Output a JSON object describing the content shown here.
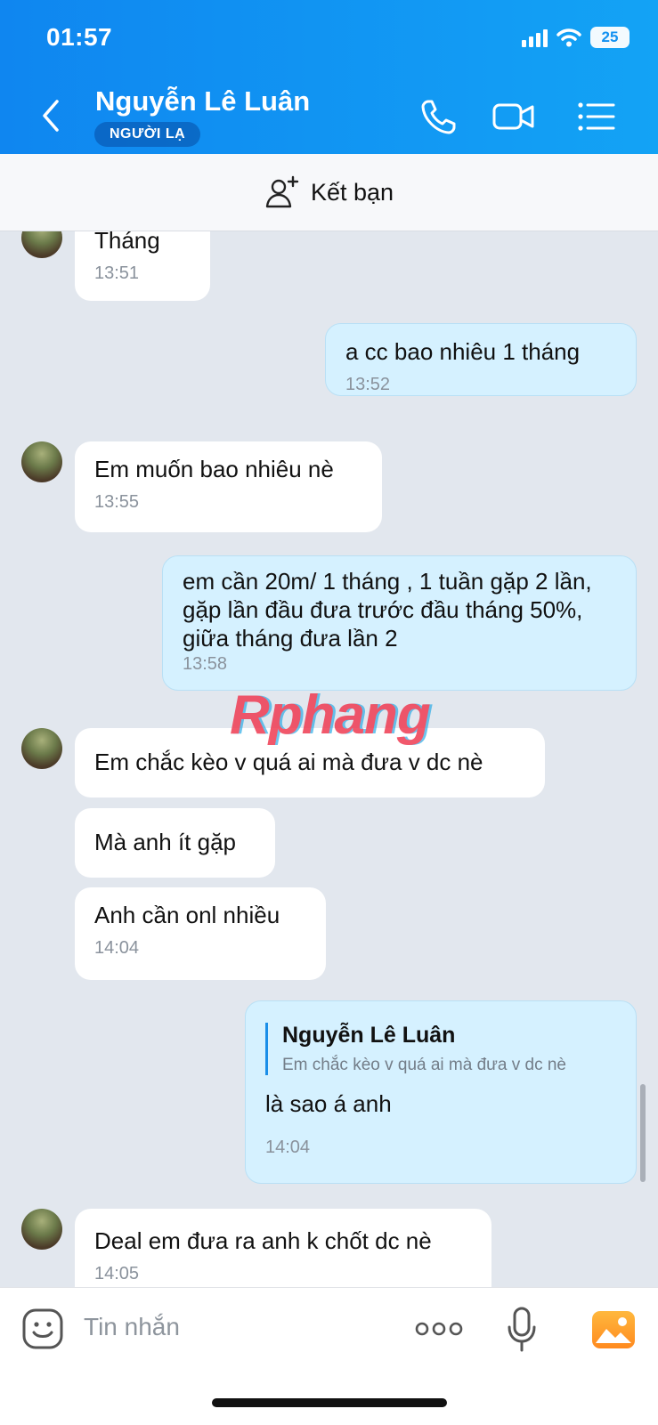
{
  "status_bar": {
    "time": "01:57",
    "battery": "25"
  },
  "header": {
    "contact_name": "Nguyễn Lê Luân",
    "badge": "NGƯỜI LẠ"
  },
  "add_friend": {
    "label": "Kết bạn"
  },
  "colors": {
    "header_start": "#0f86f0",
    "header_end": "#13a3f5",
    "outgoing_bubble": "#d5f1ff",
    "incoming_bubble": "#ffffff",
    "chat_bg": "#e2e7ee"
  },
  "messages": [
    {
      "direction": "in",
      "text": "Tháng",
      "time": "13:51"
    },
    {
      "direction": "out",
      "text": "a cc bao nhiêu 1 tháng",
      "time": "13:52"
    },
    {
      "direction": "in",
      "text": "Em muốn bao nhiêu nè",
      "time": "13:55"
    },
    {
      "direction": "out",
      "text": "em cần 20m/ 1 tháng , 1 tuần gặp 2 lần, gặp lần đầu đưa trước đầu tháng 50%, giữa tháng đưa lần 2",
      "time": "13:58"
    },
    {
      "direction": "in",
      "text": "Em chắc kèo v quá ai mà đưa v dc nè"
    },
    {
      "direction": "in",
      "text": "Mà anh ít gặp"
    },
    {
      "direction": "in",
      "text": "Anh cần onl nhiều",
      "time": "14:04"
    },
    {
      "direction": "out",
      "quote_name": "Nguyễn Lê Luân",
      "quote_text": "Em chắc kèo v quá ai mà đưa v dc nè",
      "text": "là sao á anh",
      "time": "14:04"
    },
    {
      "direction": "in",
      "text": "Deal em đưa ra anh k chốt dc nè",
      "time": "14:05"
    }
  ],
  "watermark": "Rphang",
  "composer": {
    "placeholder": "Tin nhắn"
  },
  "icons": [
    "back-icon",
    "phone-icon",
    "video-call-icon",
    "menu-list-icon",
    "add-friend-icon",
    "sticker-icon",
    "more-icon",
    "microphone-icon",
    "image-icon"
  ]
}
